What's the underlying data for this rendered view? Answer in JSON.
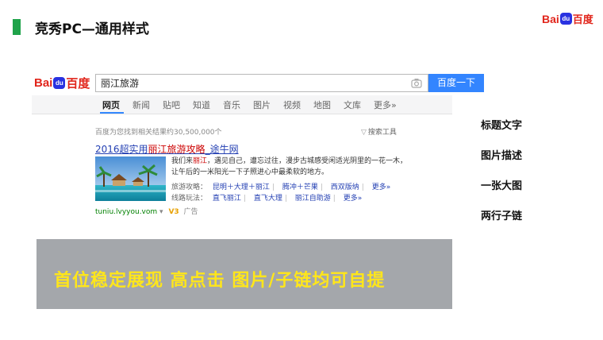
{
  "slide": {
    "title": "竞秀PC—通用样式",
    "logo_left": "Bai",
    "logo_paw": "du",
    "logo_right": "百度"
  },
  "search": {
    "logo_left": "Bai",
    "logo_paw": "du",
    "logo_right": "百度",
    "query": "丽江旅游",
    "button": "百度一下"
  },
  "tabs": [
    "网页",
    "新闻",
    "贴吧",
    "知道",
    "音乐",
    "图片",
    "视频",
    "地图",
    "文库",
    "更多»"
  ],
  "results_meta": {
    "count": "百度为您找到相关结果约30,500,000个",
    "tools": "搜索工具"
  },
  "result": {
    "title_pre": "2016超实用",
    "title_hl": "丽江旅游攻略",
    "title_post": "_途牛网",
    "desc_pre": "我们来",
    "desc_hl": "丽江",
    "desc_post": "，遇见自己，遭忘过往，漫步古城感受闲适光阴里的一花一木，让午后的一米阳光一下子照进心中最柔软的地方。",
    "row1_label": "旅游攻略：",
    "row1_links": [
      "昆明＋大理＋丽江",
      "腾冲＋芒果",
      "西双版纳",
      "更多»"
    ],
    "row2_label": "线路玩法：",
    "row2_links": [
      "直飞丽江",
      "直飞大理",
      "丽江自助游",
      "更多»"
    ],
    "url": "tuniu.lvyyou.vom",
    "v3": "V3",
    "ad": "广告"
  },
  "banner": {
    "text": "首位稳定展现   高点击   图片/子链均可自提"
  },
  "features": [
    "标题文字",
    "图片描述",
    "一张大图",
    "两行子链"
  ]
}
